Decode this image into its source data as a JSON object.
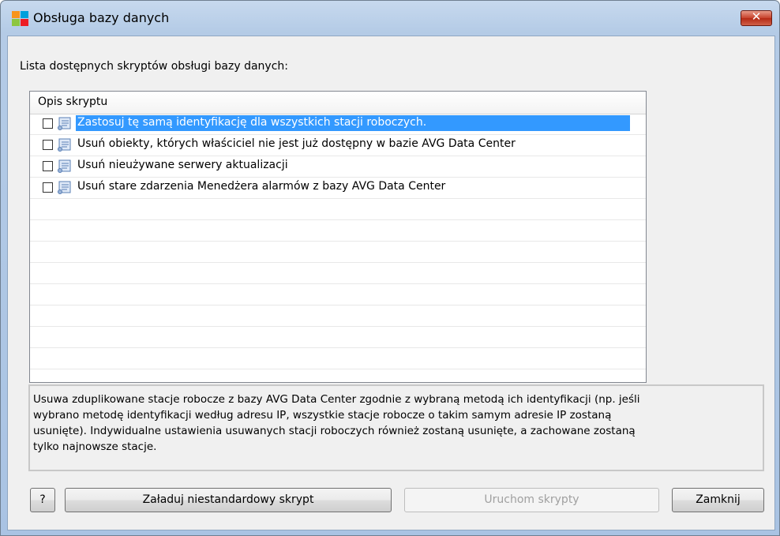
{
  "window": {
    "title": "Obsługa bazy danych",
    "close_glyph": "✕"
  },
  "list_label": "Lista dostępnych skryptów obsługi bazy danych:",
  "table": {
    "column_header": "Opis skryptu",
    "rows": [
      {
        "label": "Zastosuj tę samą identyfikację dla wszystkich stacji roboczych.",
        "checked": false,
        "selected": true
      },
      {
        "label": "Usuń obiekty, których właściciel nie jest już dostępny w bazie AVG Data Center",
        "checked": false,
        "selected": false
      },
      {
        "label": "Usuń nieużywane serwery aktualizacji",
        "checked": false,
        "selected": false
      },
      {
        "label": "Usuń stare zdarzenia Menedżera alarmów z bazy AVG Data Center",
        "checked": false,
        "selected": false
      }
    ]
  },
  "description": "Usuwa zduplikowane stacje robocze z bazy AVG Data Center zgodnie z wybraną metodą ich identyfikacji (np. jeśli wybrano metodę identyfikacji według adresu IP, wszystkie stacje robocze o takim samym adresie IP zostaną usunięte). Indywidualne ustawienia usuwanych stacji roboczych również zostaną usunięte, a zachowane zostaną tylko najnowsze stacje.",
  "buttons": {
    "help": "?",
    "load_custom": "Załaduj niestandardowy skrypt",
    "run_scripts": "Uruchom skrypty",
    "close": "Zamknij"
  },
  "colors": {
    "selection": "#3399ff",
    "frame": "#b4cbe6"
  },
  "icons": {
    "app": "avg-logo-icon",
    "script": "script-scroll-icon"
  }
}
